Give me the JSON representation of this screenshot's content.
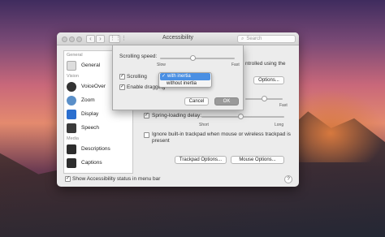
{
  "window": {
    "title": "Accessibility",
    "search_placeholder": "Search",
    "back_glyph": "‹",
    "forward_glyph": "›",
    "grid_glyph": "⋮⋮⋮"
  },
  "sidebar": {
    "sections": [
      {
        "label": "General"
      },
      {
        "label": "Vision"
      },
      {
        "label": "Media"
      }
    ],
    "items": [
      {
        "label": "General",
        "icon": "general-icon"
      },
      {
        "label": "VoiceOver",
        "icon": "voiceover-icon"
      },
      {
        "label": "Zoom",
        "icon": "zoom-icon"
      },
      {
        "label": "Display",
        "icon": "display-icon"
      },
      {
        "label": "Speech",
        "icon": "speech-icon"
      },
      {
        "label": "Descriptions",
        "icon": "descriptions-icon"
      },
      {
        "label": "Captions",
        "icon": "captions-icon"
      }
    ]
  },
  "main": {
    "controlled_text": "ntrolled using the",
    "options_button": "Options...",
    "fast_label": "Fast",
    "spring_loading_label": "Spring-loading delay:",
    "short_label": "Short",
    "long_label": "Long",
    "ignore_text_line1": "Ignore built-in trackpad when mouse or wireless trackpad is",
    "ignore_text_line2": "present",
    "trackpad_options_button": "Trackpad Options...",
    "mouse_options_button": "Mouse Options..."
  },
  "footer": {
    "show_status_label": "Show Accessibility status in menu bar",
    "help_label": "?"
  },
  "sheet": {
    "scrolling_speed_label": "Scrolling speed:",
    "slow_label": "Slow",
    "fast_label": "Fast",
    "scrolling_label": "Scrolling",
    "enable_dragging_label": "Enable dragging",
    "cancel_button": "Cancel",
    "ok_button": "OK"
  },
  "scroll_menu": {
    "options": [
      "with inertia",
      "without inertia"
    ],
    "selected": "with inertia",
    "check_glyph": "✓"
  },
  "colors": {
    "accent": "#4a8fe3",
    "window_bg": "#ececec"
  }
}
